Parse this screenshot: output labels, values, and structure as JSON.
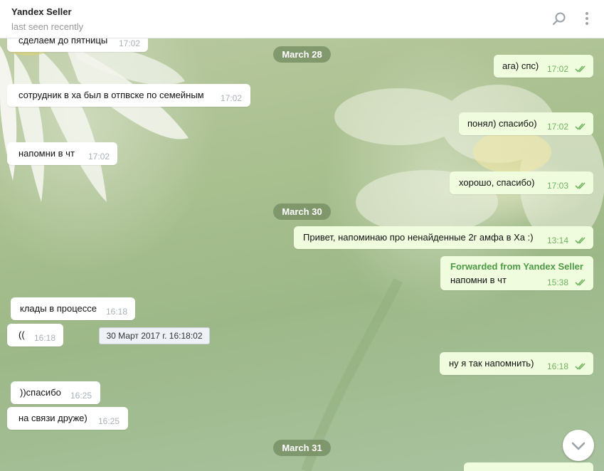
{
  "header": {
    "chat_name": "Yandex Seller",
    "status": "last seen recently",
    "icons": [
      "search-icon",
      "more-vertical-icon"
    ]
  },
  "colors": {
    "incoming_bubble": "#ffffff",
    "outgoing_bubble": "#effdde",
    "outgoing_time": "#6fb35e",
    "forwarded_title": "#4c9a44",
    "date_pill": "#748c60"
  },
  "messages": {
    "m0": {
      "text": "сделаем до пятницы",
      "time": "17:02"
    },
    "m1": {
      "text": "ага) спс)",
      "time": "17:02"
    },
    "m2": {
      "text": "сотрудник в ха был в отпвске по семейным",
      "time": "17:02"
    },
    "m3": {
      "text": "понял) спасибо)",
      "time": "17:02"
    },
    "m4": {
      "text": "напомни в чт",
      "time": "17:02"
    },
    "m5": {
      "text": "хорошо, спасибо)",
      "time": "17:03"
    },
    "m6": {
      "text": "Привет, напоминаю про ненайденные 2г амфа в Ха :)",
      "time": "13:14"
    },
    "m7": {
      "forwarded_label": "Forwarded from Yandex Seller",
      "text": "напомни в чт",
      "time": "15:38"
    },
    "m8": {
      "text": "клады в процессе",
      "time": "16:18"
    },
    "m9": {
      "text": "((",
      "time": "16:18"
    },
    "m10": {
      "text": "ну я так напомнить)",
      "time": "16:18"
    },
    "m11": {
      "text": "))спасибо",
      "time": "16:25"
    },
    "m12": {
      "text": "на связи друже)",
      "time": "16:25"
    }
  },
  "dates": {
    "d1": "March 28",
    "d2": "March 30",
    "d3": "March 31"
  },
  "tooltip": "30 Март 2017 г. 16:18:02",
  "scroll_down_icon": "chevron-down-icon"
}
